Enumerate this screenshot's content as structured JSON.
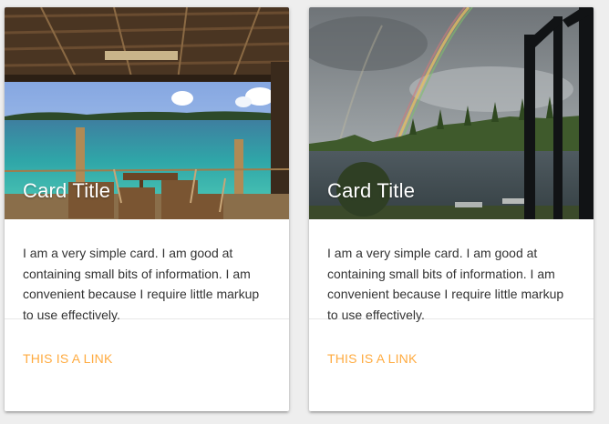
{
  "cards": [
    {
      "title": "Card Title",
      "image": "tropical-beach-veranda-photo",
      "content": "I am a very simple card. I am good at containing small bits of information. I am convenient because I require little markup to use effectively.",
      "link_label": "This is a link"
    },
    {
      "title": "Card Title",
      "image": "lake-rainbow-photo",
      "content": "I am a very simple card. I am good at containing small bits of information. I am convenient because I require little markup to use effectively.",
      "link_label": "This is a link"
    }
  ],
  "colors": {
    "background": "#eeeeee",
    "card": "#ffffff",
    "link": "#ffab40",
    "text": "#333333"
  }
}
